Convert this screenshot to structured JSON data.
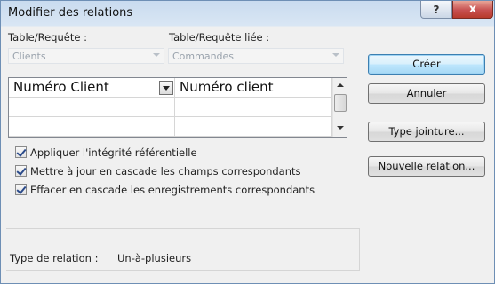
{
  "window": {
    "title": "Modifier des relations",
    "help_label": "?",
    "close_label": "x"
  },
  "table": {
    "label": "Table/Requête :",
    "value": "Clients"
  },
  "related_table": {
    "label": "Table/Requête liée :",
    "value": "Commandes"
  },
  "grid": {
    "row1_left": "Numéro Client",
    "row1_right": "Numéro client"
  },
  "options": {
    "integrity": {
      "label": "Appliquer l'intégrité référentielle",
      "checked": true
    },
    "cascade_update": {
      "label": "Mettre à jour en cascade les champs correspondants",
      "checked": true
    },
    "cascade_delete": {
      "label": "Effacer en cascade les enregistrements correspondants",
      "checked": true
    }
  },
  "relation": {
    "label": "Type de relation :",
    "value": "Un-à-plusieurs"
  },
  "buttons": {
    "create": "Créer",
    "cancel": "Annuler",
    "join_type": "Type jointure...",
    "new_relation": "Nouvelle relation..."
  },
  "icons": [
    "help-icon",
    "close-icon",
    "dropdown-arrow-icon",
    "scroll-up-icon",
    "scroll-down-icon",
    "checkmark-icon"
  ]
}
